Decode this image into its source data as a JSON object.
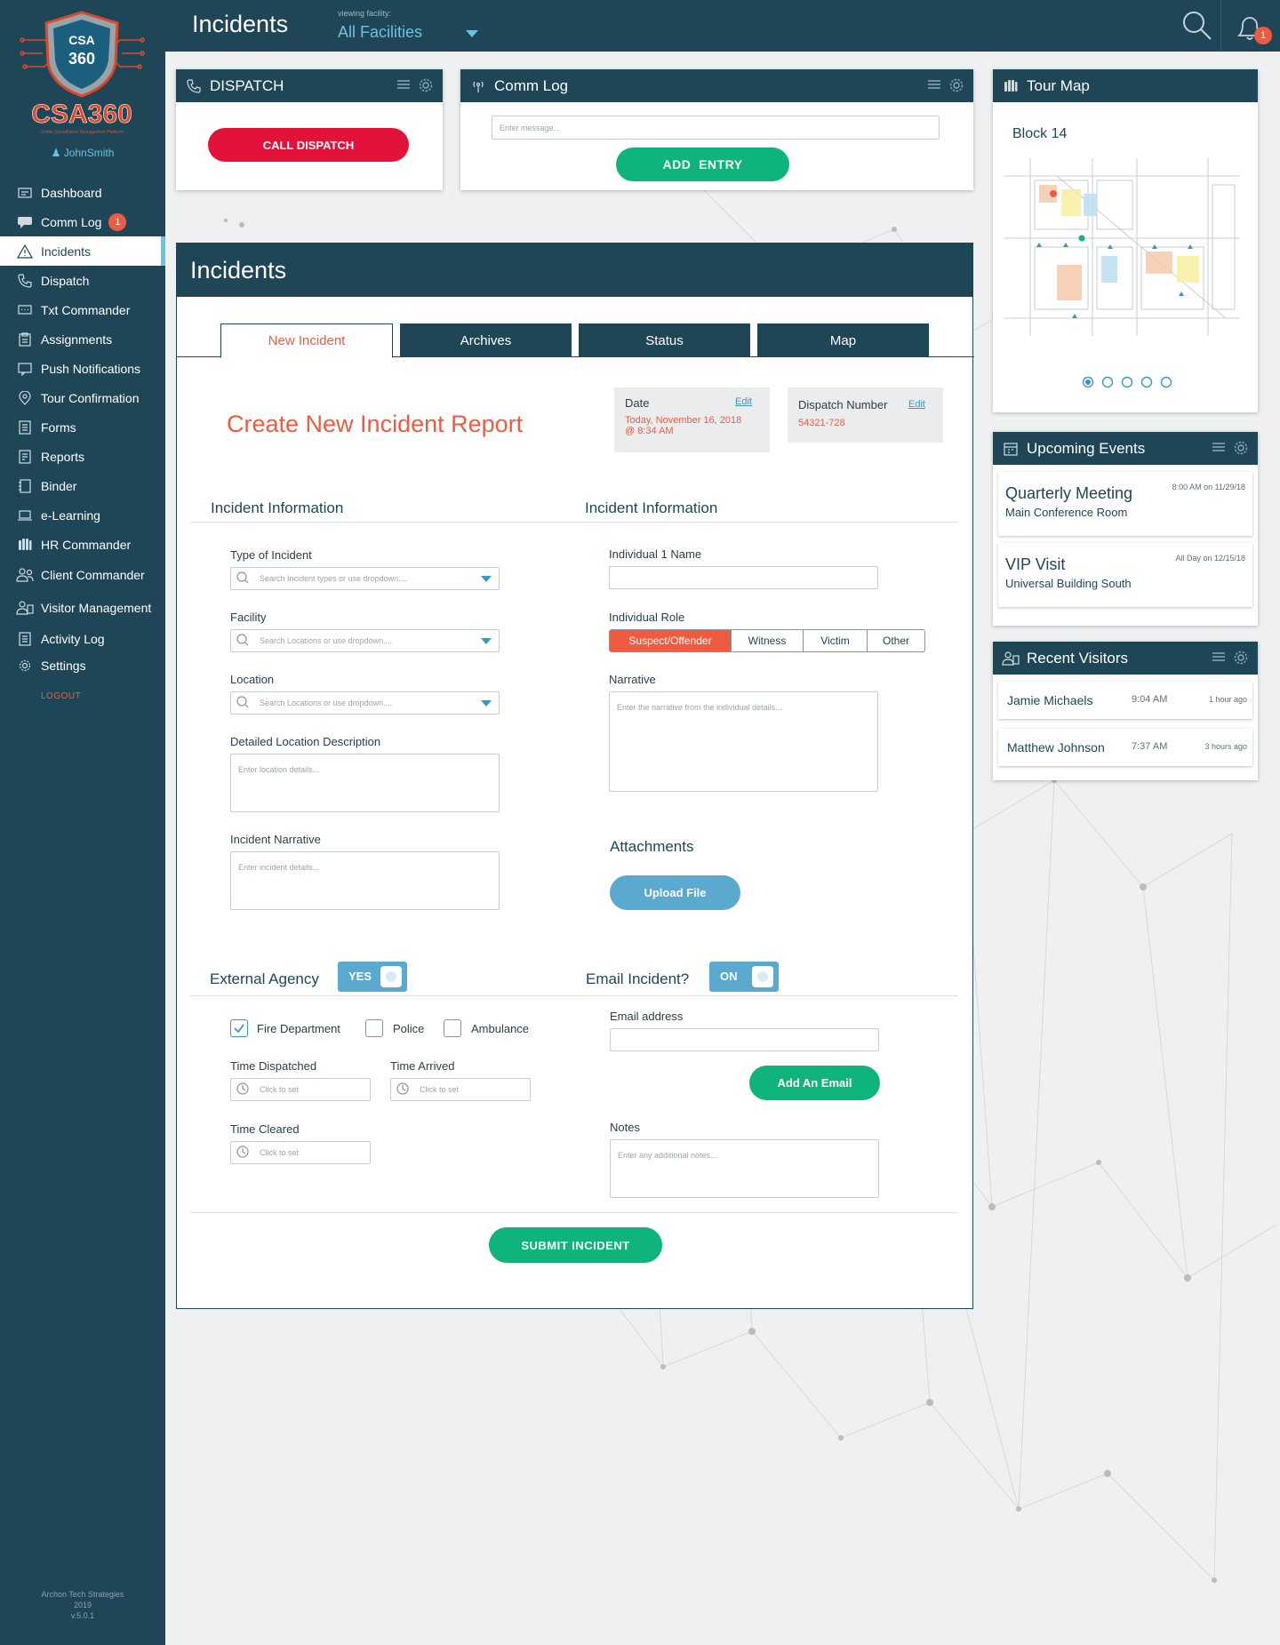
{
  "app": {
    "name": "CSA360",
    "tagline": "Onsite Surveillance Management Platform",
    "user": "JohnSmith"
  },
  "sidebar": {
    "items": [
      {
        "label": "Dashboard",
        "icon": "dashboard-icon"
      },
      {
        "label": "Comm Log",
        "icon": "chat-icon",
        "badge": "1"
      },
      {
        "label": "Incidents",
        "icon": "warning-icon",
        "active": true
      },
      {
        "label": "Dispatch",
        "icon": "phone-icon"
      },
      {
        "label": "Txt Commander",
        "icon": "message-icon"
      },
      {
        "label": "Assignments",
        "icon": "clipboard-icon"
      },
      {
        "label": "Push Notifications",
        "icon": "notification-icon"
      },
      {
        "label": "Tour Confirmation",
        "icon": "location-pin-icon"
      },
      {
        "label": "Forms",
        "icon": "document-icon"
      },
      {
        "label": "Reports",
        "icon": "report-icon"
      },
      {
        "label": "Binder",
        "icon": "binder-icon"
      },
      {
        "label": "e-Learning",
        "icon": "laptop-icon"
      },
      {
        "label": "HR Commander",
        "icon": "people-icon"
      },
      {
        "label": "Client Commander",
        "icon": "client-icon"
      },
      {
        "label": "Visitor Management",
        "icon": "visitor-icon"
      },
      {
        "label": "Activity Log",
        "icon": "log-icon"
      },
      {
        "label": "Settings",
        "icon": "gear-icon"
      }
    ],
    "logout": "LOGOUT",
    "footer": {
      "company": "Archon Tech Strategies",
      "year": "2019",
      "version": "v.5.0.1"
    }
  },
  "topbar": {
    "title": "Incidents",
    "facility_label": "viewing facility:",
    "facility_value": "All Facilities",
    "notification_count": "1"
  },
  "dispatch": {
    "title": "DISPATCH",
    "button": "CALL DISPATCH"
  },
  "comm_log": {
    "title": "Comm Log",
    "placeholder": "Enter message...",
    "button": "ADD  ENTRY"
  },
  "tour_map": {
    "title": "Tour Map",
    "block": "Block 14",
    "pages": 5,
    "current_page": 1
  },
  "upcoming_events": {
    "title": "Upcoming Events",
    "items": [
      {
        "name": "Quarterly Meeting",
        "place": "Main Conference Room",
        "when": "8:00 AM on 11/29/18"
      },
      {
        "name": "VIP Visit",
        "place": "Universal Building South",
        "when": "All Day on 12/15/18"
      }
    ]
  },
  "recent_visitors": {
    "title": "Recent Visitors",
    "items": [
      {
        "name": "Jamie Michaels",
        "time": "9:04 AM",
        "ago": "1 hour ago"
      },
      {
        "name": "Matthew Johnson",
        "time": "7:37 AM",
        "ago": "3 hours ago"
      }
    ]
  },
  "incidents": {
    "title": "Incidents",
    "tabs": [
      "New Incident",
      "Archives",
      "Status",
      "Map"
    ],
    "active_tab": "New Incident",
    "heading": "Create New Incident Report",
    "date": {
      "label": "Date",
      "edit": "Edit",
      "value_line1": "Today, November 16, 2018",
      "value_line2": "@ 8:34 AM"
    },
    "dispatch_number": {
      "label": "Dispatch Number",
      "edit": "Edit",
      "value": "54321-728"
    },
    "left_section": "Incident Information",
    "right_section": "Incident Information",
    "type_of_incident": {
      "label": "Type of Incident",
      "placeholder": "Search Incident types or use dropdown...."
    },
    "facility": {
      "label": "Facility",
      "placeholder": "Search Locations or use dropdown...."
    },
    "location": {
      "label": "Location",
      "placeholder": "Search Locations or use dropdown...."
    },
    "location_desc": {
      "label": "Detailed Location Description",
      "placeholder": "Enter location details..."
    },
    "narrative_left": {
      "label": "Incident Narrative",
      "placeholder": "Enter incident details..."
    },
    "individual_name": {
      "label": "Individual 1 Name",
      "value": ""
    },
    "individual_role": {
      "label": "Individual Role",
      "options": [
        "Suspect/Offender",
        "Witness",
        "Victim",
        "Other"
      ],
      "selected": "Suspect/Offender"
    },
    "narrative_right": {
      "label": "Narrative",
      "placeholder": "Enter the narrative from the individual details..."
    },
    "attachments": {
      "label": "Attachments",
      "button": "Upload File"
    },
    "external_agency": {
      "label": "External Agency",
      "toggle": "YES"
    },
    "email_incident": {
      "label": "Email Incident?",
      "toggle": "ON"
    },
    "agencies": [
      {
        "label": "Fire Department",
        "checked": true
      },
      {
        "label": "Police",
        "checked": false
      },
      {
        "label": "Ambulance",
        "checked": false
      }
    ],
    "time_dispatched": {
      "label": "Time Dispatched",
      "placeholder": "Click to set"
    },
    "time_arrived": {
      "label": "Time Arrived",
      "placeholder": "Click to set"
    },
    "time_cleared": {
      "label": "Time Cleared",
      "placeholder": "Click to set"
    },
    "email": {
      "label": "Email address",
      "value": "",
      "button": "Add An Email"
    },
    "notes": {
      "label": "Notes",
      "placeholder": "Enter any additional notes..."
    },
    "submit": "SUBMIT INCIDENT"
  },
  "colors": {
    "navy": "#1f4656",
    "accent_blue": "#6cc1e4",
    "orange": "#ef5b40",
    "red": "#e2123b",
    "green": "#0fb47a"
  }
}
